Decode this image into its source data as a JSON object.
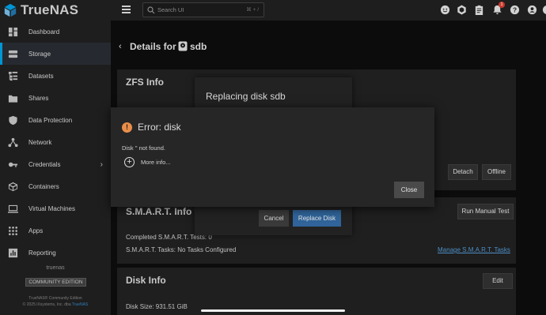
{
  "brand": {
    "name": "TrueNAS"
  },
  "sidebar": {
    "items": [
      {
        "label": "Dashboard",
        "icon": "dashboard-icon"
      },
      {
        "label": "Storage",
        "icon": "storage-icon"
      },
      {
        "label": "Datasets",
        "icon": "datasets-icon"
      },
      {
        "label": "Shares",
        "icon": "shares-icon"
      },
      {
        "label": "Data Protection",
        "icon": "shield-icon"
      },
      {
        "label": "Network",
        "icon": "network-icon"
      },
      {
        "label": "Credentials",
        "icon": "key-icon"
      },
      {
        "label": "Containers",
        "icon": "containers-icon"
      },
      {
        "label": "Virtual Machines",
        "icon": "monitor-icon"
      },
      {
        "label": "Apps",
        "icon": "apps-icon"
      },
      {
        "label": "Reporting",
        "icon": "reporting-icon"
      }
    ],
    "active": "Storage",
    "hostname": "truenas",
    "edition": "COMMUNITY EDITION",
    "copyright_line1": "TrueNAS® Community Edition",
    "copyright_line2_prefix": "© 2025 iXsystems, Inc. dba",
    "copyright_line2_link": "TrueNAS"
  },
  "topbar": {
    "search_placeholder": "Search UI",
    "search_shortcut": "⌘ + /",
    "notification_count": "1",
    "icons": [
      "feedback-icon",
      "truecommand-icon",
      "jobs-icon",
      "notifications-icon",
      "help-icon",
      "account-icon",
      "power-icon"
    ]
  },
  "page": {
    "back": "‹",
    "title": "Details for",
    "disk": "sdb"
  },
  "zfs_card": {
    "title": "ZFS Info",
    "detach": "Detach",
    "offline": "Offline"
  },
  "smart_card": {
    "title": "S.M.A.R.T. Info fo",
    "run_test": "Run Manual Test",
    "completed": "Completed S.M.A.R.T. Tests: 0",
    "tasks": "S.M.A.R.T. Tasks: No Tasks Configured",
    "manage": "Manage S.M.A.R.T. Tasks"
  },
  "disk_card": {
    "title": "Disk Info",
    "edit": "Edit",
    "size": "Disk Size: 931.51 GiB"
  },
  "replace_dialog": {
    "title": "Replacing disk sdb",
    "cancel": "Cancel",
    "replace": "Replace Disk"
  },
  "error_dialog": {
    "icon_text": "!",
    "title": "Error: disk",
    "message": "Disk '' not found.",
    "more_info": "More info...",
    "close": "Close"
  },
  "colors": {
    "accent": "#0095d5",
    "primary_button": "#30649a",
    "warning": "#e88e4a",
    "badge": "#c73a2c"
  }
}
